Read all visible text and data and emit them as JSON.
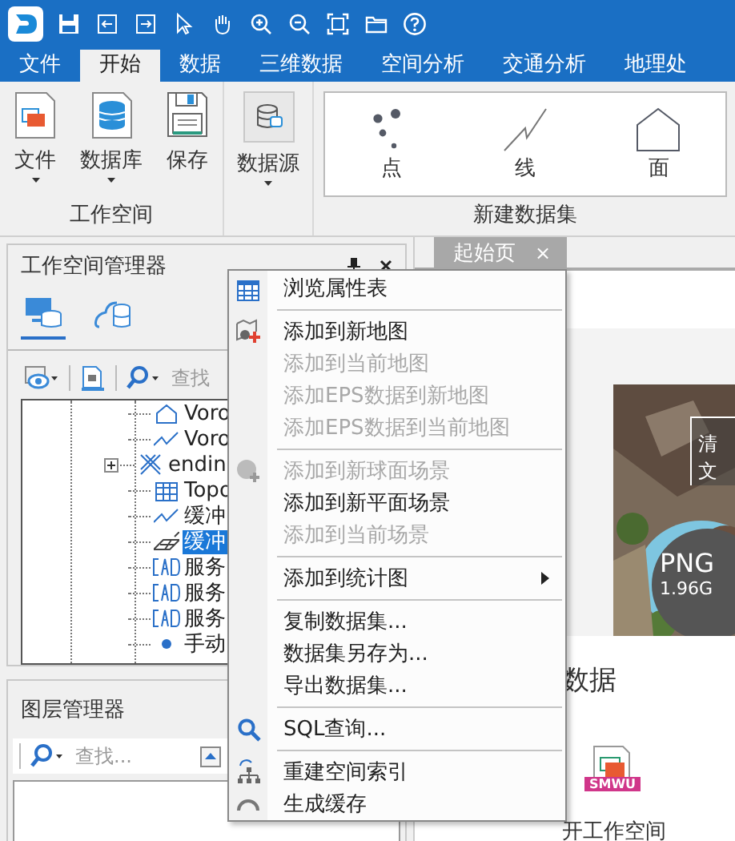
{
  "ribbon_tabs": [
    {
      "label": "文件",
      "selected": false
    },
    {
      "label": "开始",
      "selected": true
    },
    {
      "label": "数据",
      "selected": false
    },
    {
      "label": "三维数据",
      "selected": false
    },
    {
      "label": "空间分析",
      "selected": false
    },
    {
      "label": "交通分析",
      "selected": false
    },
    {
      "label": "地理处",
      "selected": false
    }
  ],
  "ribbon_groups": [
    {
      "title": "工作空间",
      "buttons": [
        {
          "label": "文件",
          "kind": "file",
          "dropdown": true
        },
        {
          "label": "数据库",
          "kind": "database",
          "dropdown": true
        },
        {
          "label": "保存",
          "kind": "save",
          "dropdown": false
        }
      ]
    },
    {
      "buttons": [
        {
          "label": "数据源",
          "kind": "datasource",
          "dropdown": true
        }
      ]
    },
    {
      "title": "新建数据集",
      "gallery": [
        {
          "label": "点",
          "kind": "point"
        },
        {
          "label": "线",
          "kind": "line"
        },
        {
          "label": "面",
          "kind": "region"
        }
      ]
    }
  ],
  "workspace_panel": {
    "title": "工作空间管理器",
    "tabs": [
      {
        "kind": "workspace",
        "selected": true
      },
      {
        "kind": "cloud",
        "selected": false
      }
    ],
    "search_placeholder": "查找",
    "tree": [
      {
        "label": "Voro",
        "kind": "region",
        "selected": false
      },
      {
        "label": "Voro",
        "kind": "line",
        "selected": false
      },
      {
        "label": "endin",
        "kind": "network",
        "selected": false,
        "expandable": true
      },
      {
        "label": "Topo",
        "kind": "tabular",
        "selected": false
      },
      {
        "label": "缓冲",
        "kind": "line",
        "selected": false
      },
      {
        "label": "缓冲",
        "kind": "grid",
        "selected": true
      },
      {
        "label": "服务",
        "kind": "cad",
        "selected": false
      },
      {
        "label": "服务",
        "kind": "cad",
        "selected": false
      },
      {
        "label": "服务",
        "kind": "cad",
        "selected": false
      },
      {
        "label": "手动",
        "kind": "point",
        "selected": false
      }
    ]
  },
  "layers_panel": {
    "title": "图层管理器",
    "search_placeholder": "查找..."
  },
  "document_tab": {
    "label": "起始页",
    "close": "×"
  },
  "start_page": {
    "card": {
      "title": "清",
      "subtitle": "文",
      "format": "PNG",
      "size": "1.96G"
    },
    "section_title": "数据",
    "file": {
      "badge": "SMWU",
      "label": "开工作空间"
    }
  },
  "context_menu": [
    {
      "kind": "table",
      "label": "浏览属性表",
      "enabled": true
    },
    {
      "kind": "separator"
    },
    {
      "kind": "map",
      "label": "添加到新地图",
      "enabled": true
    },
    {
      "kind": "item",
      "label": "添加到当前地图",
      "enabled": false
    },
    {
      "kind": "item",
      "label": "添加EPS数据到新地图",
      "enabled": false
    },
    {
      "kind": "item",
      "label": "添加EPS数据到当前地图",
      "enabled": false
    },
    {
      "kind": "separator"
    },
    {
      "kind": "globe",
      "label": "添加到新球面场景",
      "enabled": false
    },
    {
      "kind": "item",
      "label": "添加到新平面场景",
      "enabled": true
    },
    {
      "kind": "item",
      "label": "添加到当前场景",
      "enabled": false
    },
    {
      "kind": "separator"
    },
    {
      "kind": "item",
      "label": "添加到统计图",
      "enabled": true,
      "submenu": true
    },
    {
      "kind": "separator"
    },
    {
      "kind": "item",
      "label": "复制数据集...",
      "enabled": true
    },
    {
      "kind": "item",
      "label": "数据集另存为...",
      "enabled": true
    },
    {
      "kind": "item",
      "label": "导出数据集...",
      "enabled": true
    },
    {
      "kind": "separator"
    },
    {
      "kind": "search",
      "label": "SQL查询...",
      "enabled": true
    },
    {
      "kind": "separator"
    },
    {
      "kind": "hierarchy",
      "label": "重建空间索引",
      "enabled": true
    },
    {
      "kind": "refresh",
      "label": "生成缓存",
      "enabled": true
    }
  ]
}
